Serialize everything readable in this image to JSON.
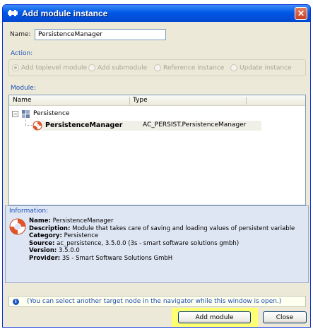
{
  "window": {
    "title": "Add module instance",
    "close_glyph": "✕"
  },
  "name": {
    "label": "Name:",
    "value": "PersistenceManager"
  },
  "action": {
    "legend": "Action:",
    "options": [
      {
        "label": "Add toplevel module",
        "checked": true
      },
      {
        "label": "Add submodule",
        "checked": false
      },
      {
        "label": "Reference instance",
        "checked": false
      },
      {
        "label": "Update instance",
        "checked": false
      }
    ]
  },
  "module": {
    "legend": "Module:",
    "columns": [
      "Name",
      "Type"
    ],
    "tree": {
      "expander": "−",
      "root_label": "Persistence",
      "child": {
        "name": "PersistenceManager",
        "type": "AC_PERSIST.PersistenceManager"
      }
    }
  },
  "information": {
    "legend": "Information:",
    "fields": [
      {
        "key": "Name:",
        "value": "PersistenceManager"
      },
      {
        "key": "Description:",
        "value": "Module that takes care of saving and loading values of persistent variable"
      },
      {
        "key": "Category:",
        "value": "Persistence"
      },
      {
        "key": "Source:",
        "value": "ac_persistence, 3.5.0.0 (3s - smart software solutions gmbh)"
      },
      {
        "key": "Version:",
        "value": "3.5.0.0"
      },
      {
        "key": "Provider:",
        "value": "3S - Smart Software Solutions GmbH"
      }
    ]
  },
  "hint": {
    "icon": "i",
    "text": "(You can select another target node in the navigator while this window is open.)"
  },
  "buttons": {
    "add_module": "Add module",
    "close": "Close"
  },
  "colors": {
    "title_bar": "#0058e6",
    "legend": "#1a50b8",
    "highlight": "#ffff73",
    "info_bg": "#dfe6f3"
  },
  "icons": {
    "title": "module-icon",
    "category": "category-icon",
    "module": "lifebuoy-icon"
  }
}
